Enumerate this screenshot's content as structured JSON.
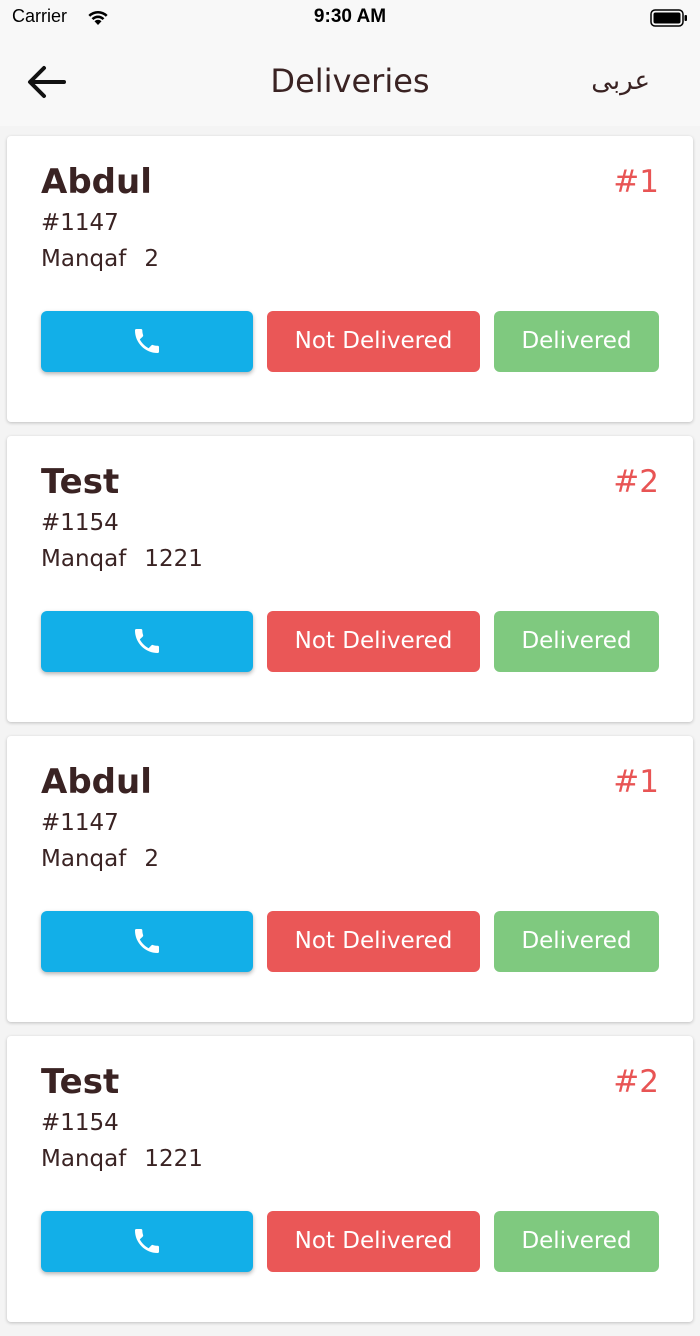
{
  "status_bar": {
    "carrier": "Carrier",
    "time": "9:30 AM"
  },
  "header": {
    "title": "Deliveries",
    "language_toggle": "عربى"
  },
  "colors": {
    "call": "#12afe8",
    "not_delivered": "#ea5757",
    "delivered": "#7fc97f",
    "queue_number": "#e85454",
    "text": "#3a2323"
  },
  "deliveries": [
    {
      "name": "Abdul",
      "queue": "#1",
      "order": "#1147",
      "area": "Manqaf",
      "block": "2",
      "not_delivered_label": "Not Delivered",
      "delivered_label": "Delivered"
    },
    {
      "name": "Test",
      "queue": "#2",
      "order": "#1154",
      "area": "Manqaf",
      "block": "1221",
      "not_delivered_label": "Not Delivered",
      "delivered_label": "Delivered"
    },
    {
      "name": "Abdul",
      "queue": "#1",
      "order": "#1147",
      "area": "Manqaf",
      "block": "2",
      "not_delivered_label": "Not Delivered",
      "delivered_label": "Delivered"
    },
    {
      "name": "Test",
      "queue": "#2",
      "order": "#1154",
      "area": "Manqaf",
      "block": "1221",
      "not_delivered_label": "Not Delivered",
      "delivered_label": "Delivered"
    }
  ]
}
